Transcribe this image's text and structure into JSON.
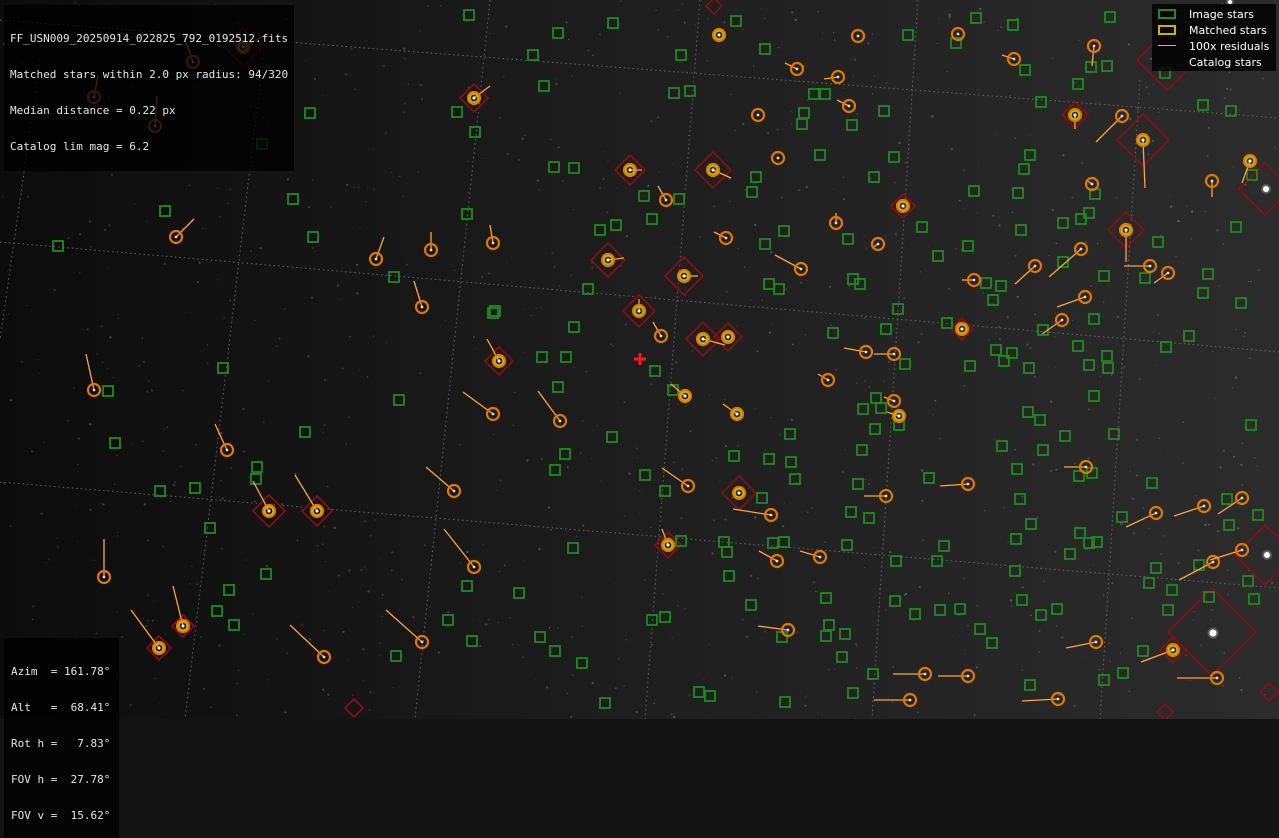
{
  "file_name": "FF_USN009_20250914_022825_792_0192512.fits",
  "header_lines": [
    "Matched stars within 2.0 px radius: 94/320",
    "Median distance = 0.22 px",
    "Catalog lim mag = 6.2"
  ],
  "pointing_lines": [
    "Azim  = 161.78°",
    "Alt   =  68.41°",
    "Rot h =   7.83°",
    "FOV h =  27.78°",
    "FOV v =  15.62°"
  ],
  "legend": [
    {
      "label": "Image stars",
      "symbol": "green-square-icon"
    },
    {
      "label": "Matched stars",
      "symbol": "yellow-ring-icon"
    },
    {
      "label": "100x residuals",
      "symbol": "orange-line-icon"
    },
    {
      "label": "Catalog stars",
      "symbol": "catalog-star-icon"
    }
  ],
  "colors": {
    "background": "#141414",
    "grid": "#7a7a7a",
    "image_star": "#1f8a1f",
    "matched_ring": "#d1b100",
    "catalog_ring": "#e07800",
    "residual": "#ffa43a",
    "catalog_diamond": "#8a0f12",
    "center_cross": "#ff1a1a"
  }
}
